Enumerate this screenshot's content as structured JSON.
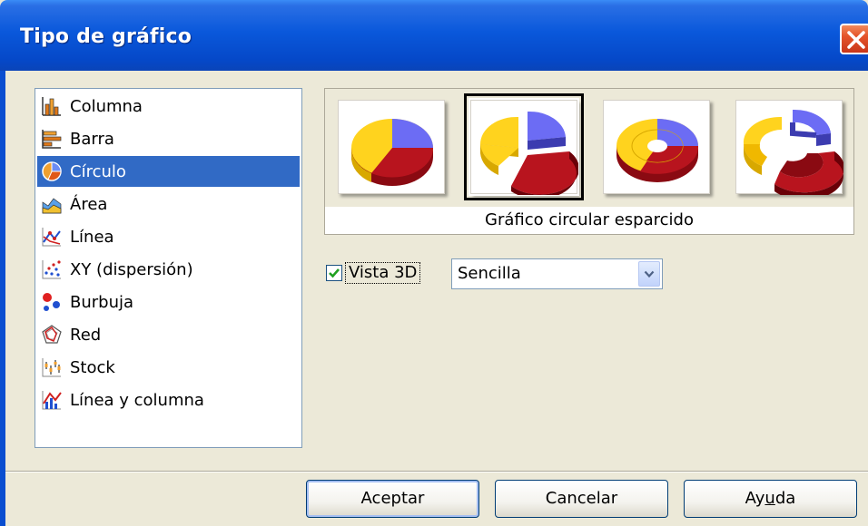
{
  "window": {
    "title": "Tipo de gráfico",
    "close_icon": "close-icon"
  },
  "chart_types": [
    {
      "label": "Columna",
      "icon": "column-chart-icon",
      "selected": false
    },
    {
      "label": "Barra",
      "icon": "bar-chart-icon",
      "selected": false
    },
    {
      "label": "Círculo",
      "icon": "pie-chart-icon",
      "selected": true
    },
    {
      "label": "Área",
      "icon": "area-chart-icon",
      "selected": false
    },
    {
      "label": "Línea",
      "icon": "line-chart-icon",
      "selected": false
    },
    {
      "label": "XY (dispersión)",
      "icon": "scatter-chart-icon",
      "selected": false
    },
    {
      "label": "Burbuja",
      "icon": "bubble-chart-icon",
      "selected": false
    },
    {
      "label": "Red",
      "icon": "net-chart-icon",
      "selected": false
    },
    {
      "label": "Stock",
      "icon": "stock-chart-icon",
      "selected": false
    },
    {
      "label": "Línea y columna",
      "icon": "line-column-chart-icon",
      "selected": false
    }
  ],
  "gallery": {
    "caption": "Gráfico circular esparcido",
    "variants": [
      "pie-3d",
      "exploded-pie-3d",
      "donut-3d",
      "exploded-donut-3d"
    ],
    "selected_index": 1
  },
  "options": {
    "view3d_label": "Vista 3D",
    "view3d_checked": true,
    "shape_value": "Sencilla"
  },
  "buttons": {
    "ok": "Aceptar",
    "cancel": "Cancelar",
    "help_prefix": "Ay",
    "help_accel": "u",
    "help_suffix": "da"
  },
  "colors": {
    "selection": "#316ac5",
    "pie_yellow": "#ffd31e",
    "pie_red": "#b8141e",
    "pie_blue": "#6c6cf4"
  }
}
